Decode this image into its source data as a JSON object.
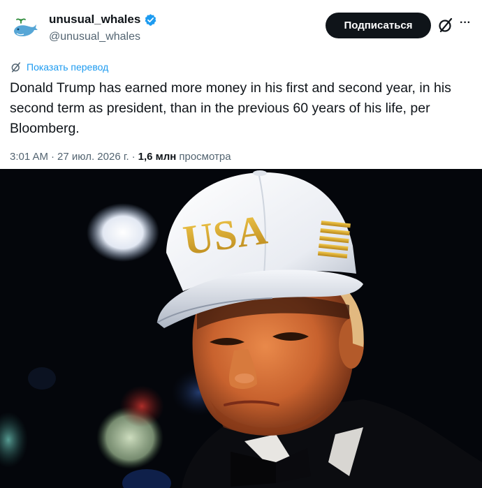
{
  "author": {
    "display_name": "unusual_whales",
    "handle": "@unusual_whales",
    "avatar": "whale-logo",
    "verified": true
  },
  "follow_button": {
    "label": "Подписаться"
  },
  "icons": {
    "grok": "grok-slash-circle-icon",
    "more": "more-dots-icon",
    "verified": "verified-badge-icon"
  },
  "translate": {
    "label": "Показать перевод"
  },
  "tweet": {
    "text": "Donald Trump has earned more money in his first and second year, in his second term as president, than in the previous 60 years of his life, per Bloomberg."
  },
  "meta": {
    "time": "3:01 AM",
    "separator1": "·",
    "date": "27 июл. 2026 г.",
    "separator2": "·",
    "views_count": "1,6 млн",
    "views_label": "просмотра"
  },
  "photo": {
    "cap_text": "USA",
    "description_icon": "portrait-photo"
  },
  "colors": {
    "link_blue": "#1d9bf0",
    "text_primary": "#0f1419",
    "text_secondary": "#536471",
    "button_black": "#0f1419"
  }
}
